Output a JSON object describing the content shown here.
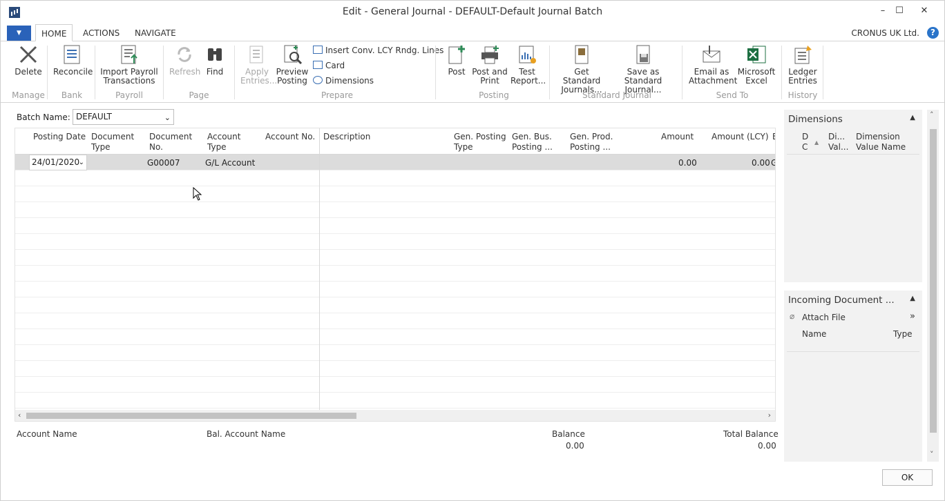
{
  "window": {
    "title": "Edit - General Journal - DEFAULT-Default Journal Batch",
    "minimize": "–",
    "maximize": "☐",
    "close": "✕"
  },
  "tabs": [
    "HOME",
    "ACTIONS",
    "NAVIGATE"
  ],
  "company": "CRONUS UK Ltd.",
  "ribbon": {
    "delete": "Delete",
    "reconcile": "Reconcile",
    "import_payroll": "Import Payroll Transactions",
    "refresh": "Refresh",
    "find": "Find",
    "apply_entries": "Apply Entries...",
    "preview_posting": "Preview Posting",
    "insert_conv": "Insert Conv. LCY Rndg. Lines",
    "card": "Card",
    "dimensions": "Dimensions",
    "post": "Post",
    "post_and_print": "Post and Print",
    "test_report": "Test Report...",
    "get_standard": "Get Standard Journals...",
    "save_standard": "Save as Standard Journal...",
    "email_attachment": "Email as Attachment",
    "microsoft_excel": "Microsoft Excel",
    "ledger_entries": "Ledger Entries",
    "groups": {
      "manage": "Manage",
      "bank": "Bank",
      "payroll": "Payroll",
      "page": "Page",
      "prepare": "Prepare",
      "posting": "Posting",
      "standard_journal": "Standard Journal",
      "send_to": "Send To",
      "history": "History"
    }
  },
  "batch": {
    "label": "Batch Name:",
    "value": "DEFAULT"
  },
  "grid": {
    "columns": {
      "posting_date": "Posting Date",
      "document_type": "Document Type",
      "document_no": "Document No.",
      "account_type": "Account Type",
      "account_no": "Account No.",
      "description": "Description",
      "gen_posting_type": "Gen. Posting Type",
      "gen_bus_posting": "Gen. Bus. Posting ...",
      "gen_prod_posting": "Gen. Prod. Posting ...",
      "amount": "Amount",
      "amount_lcy": "Amount (LCY)",
      "bal_partial": "B"
    },
    "row": {
      "posting_date": "24/01/2020",
      "document_no": "G00007",
      "account_type": "G/L Account",
      "amount": "0.00",
      "amount_lcy": "0.00",
      "bal_partial": "G"
    }
  },
  "footer": {
    "account_name": "Account Name",
    "bal_account_name": "Bal. Account Name",
    "balance": "Balance",
    "balance_value": "0.00",
    "total_balance": "Total Balance",
    "total_balance_value": "0.00"
  },
  "factbox_dimensions": {
    "title": "Dimensions",
    "col1": "D C",
    "col2": "Di... Val...",
    "col3": "Dimension Value Name"
  },
  "factbox_incoming": {
    "title": "Incoming Document ...",
    "attach_file": "Attach File",
    "col_name": "Name",
    "col_type": "Type"
  },
  "ok_button": "OK"
}
